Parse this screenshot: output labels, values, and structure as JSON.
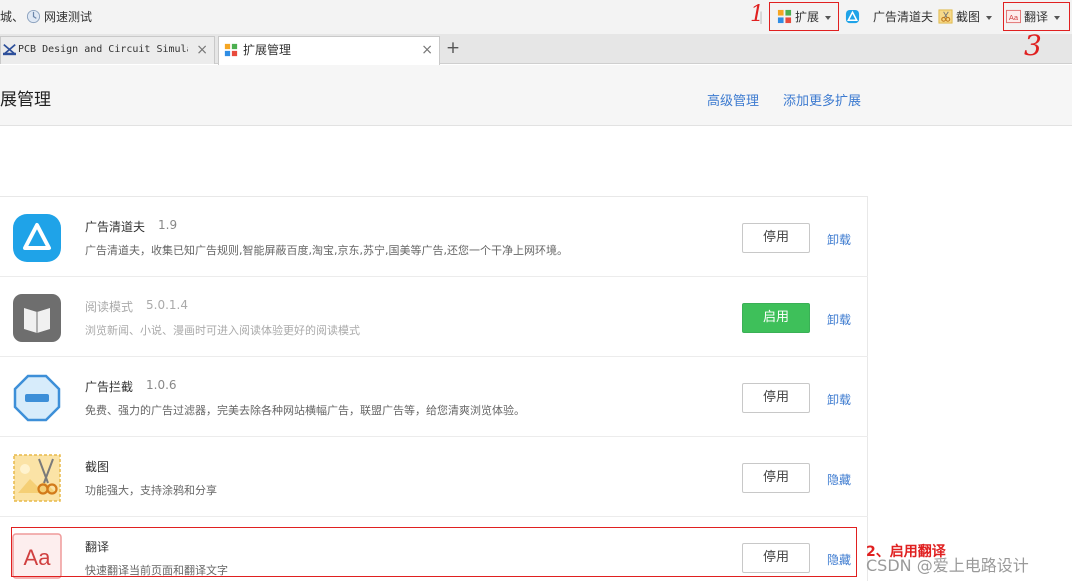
{
  "toolbar": {
    "left_items": [
      {
        "label": "城、",
        "icon": "none"
      },
      {
        "label": "网速测试",
        "icon": "globe-icon"
      }
    ],
    "extensions_button": "扩展",
    "adblock_label": "广告清道夫",
    "screenshot_label": "截图",
    "translate_label": "翻译"
  },
  "tabs": [
    {
      "label": "PCB Design and Circuit Simula",
      "active": false
    },
    {
      "label": "扩展管理",
      "active": true
    }
  ],
  "header": {
    "title": "展管理",
    "links": [
      "高级管理",
      "添加更多扩展"
    ]
  },
  "extensions": [
    {
      "name": "广告清道夫",
      "version": "1.9",
      "description": "广告清道夫，收集已知广告规则,智能屏蔽百度,淘宝,京东,苏宁,国美等广告,还您一个干净上网环境。",
      "button": "停用",
      "link": "卸载",
      "enabled": true,
      "icon": "adblock-icon"
    },
    {
      "name": "阅读模式",
      "version": "5.0.1.4",
      "description": "浏览新闻、小说、漫画时可进入阅读体验更好的阅读模式",
      "button": "启用",
      "link": "卸载",
      "enabled": false,
      "icon": "book-icon"
    },
    {
      "name": "广告拦截",
      "version": "1.0.6",
      "description": "免费、强力的广告过滤器，完美去除各种网站横幅广告，联盟广告等，给您清爽浏览体验。",
      "button": "停用",
      "link": "卸载",
      "enabled": true,
      "icon": "stop-sign-icon"
    },
    {
      "name": "截图",
      "version": "",
      "description": "功能强大，支持涂鸦和分享",
      "button": "停用",
      "link": "隐藏",
      "enabled": true,
      "icon": "scissors-icon"
    },
    {
      "name": "翻译",
      "version": "",
      "description": "快速翻译当前页面和翻译文字",
      "button": "停用",
      "link": "隐藏",
      "enabled": true,
      "icon": "translate-icon"
    }
  ],
  "annotations": {
    "step1": "1",
    "step2": "2、启用翻译",
    "step3": "3",
    "color": "#e02020"
  },
  "watermark": "CSDN @爱上电路设计",
  "colors": {
    "link": "#3d7bd0",
    "enable_button": "#3ec05a"
  }
}
